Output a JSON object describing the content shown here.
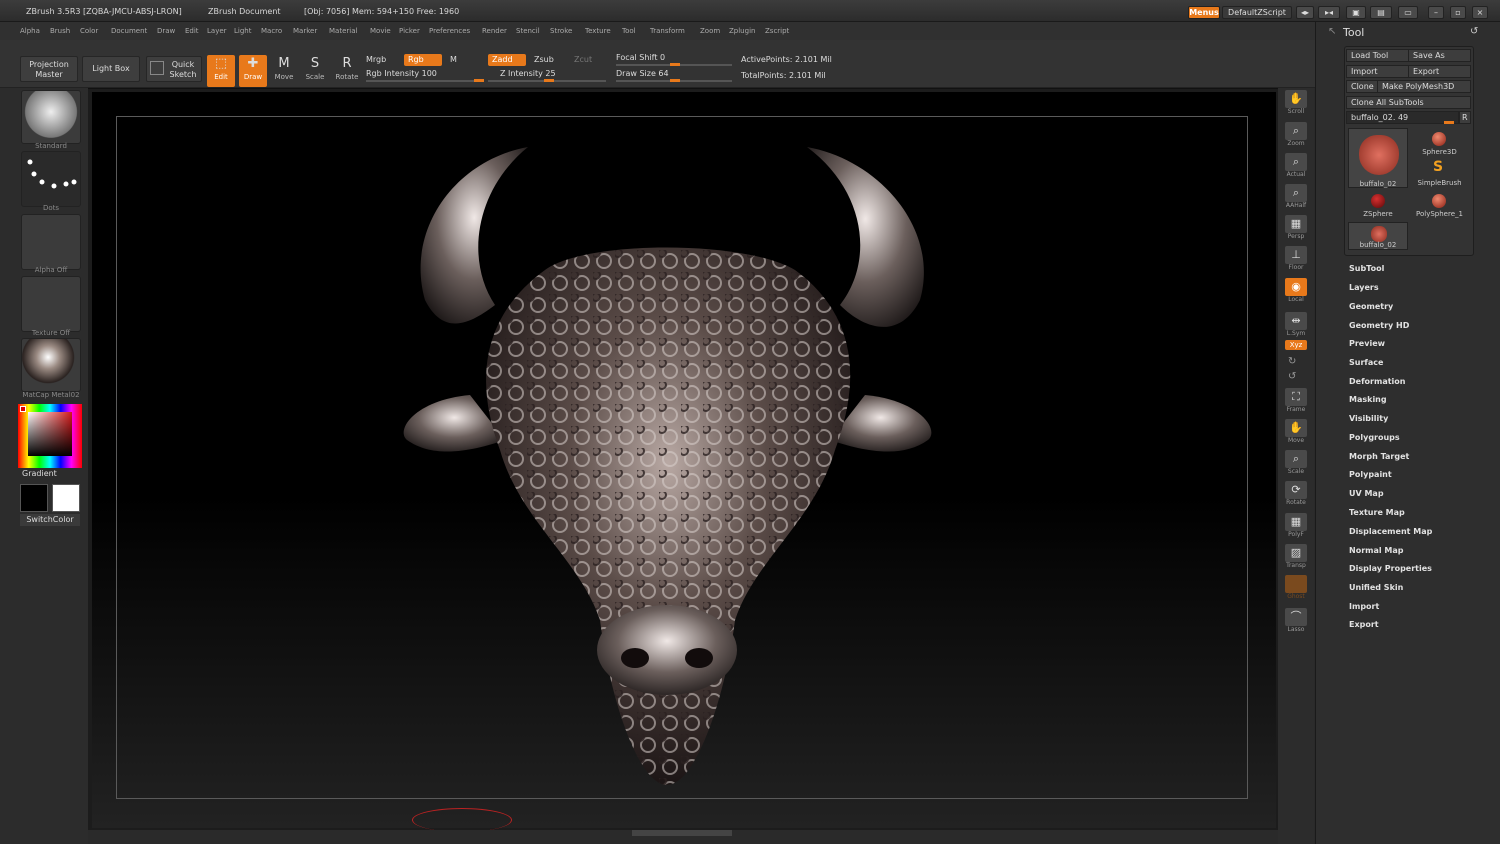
{
  "title_bar": {
    "app": "ZBrush 3.5R3 [ZQBA-JMCU-ABSJ-LRON]",
    "document": "ZBrush Document",
    "stats": "[Obj: 7056] Mem: 594+150 Free: 1960",
    "menus_label": "Menus",
    "script_label": "DefaultZScript"
  },
  "menu_items": [
    "Alpha",
    "Brush",
    "Color",
    "Document",
    "Draw",
    "Edit",
    "Layer",
    "Light",
    "Macro",
    "Marker",
    "Material",
    "Movie",
    "Picker",
    "Preferences",
    "Render",
    "Stencil",
    "Stroke",
    "Texture",
    "Tool",
    "Transform",
    "Zoom",
    "Zplugin",
    "Zscript"
  ],
  "toolbar": {
    "projection_master": "Projection Master",
    "light_box": "Light Box",
    "quick_sketch": "Quick Sketch",
    "edit": "Edit",
    "draw": "Draw",
    "move": "Move",
    "scale": "Scale",
    "rotate": "Rotate",
    "mrgb": "Mrgb",
    "rgb": "Rgb",
    "m": "M",
    "rgb_intensity": "Rgb Intensity 100",
    "zadd": "Zadd",
    "zsub": "Zsub",
    "zcut": "Zcut",
    "z_intensity": "Z Intensity 25",
    "focal_shift": "Focal Shift 0",
    "draw_size": "Draw Size 64",
    "active_points": "ActivePoints: 2.101 Mil",
    "total_points": "TotalPoints: 2.101 Mil"
  },
  "left_shelf": {
    "brush_label": "Standard",
    "stroke_label": "Dots",
    "alpha_label": "Alpha Off",
    "texture_label": "Texture Off",
    "material_label": "MatCap Metal02",
    "gradient_label": "Gradient",
    "switch_label": "SwitchColor"
  },
  "right_shelf": [
    "Scroll",
    "Zoom",
    "Actual",
    "AAHalf",
    "Persp",
    "Floor",
    "Local",
    "L.Sym",
    "Xyz",
    "Frame",
    "Move",
    "Scale",
    "Rotate",
    "PolyF",
    "Transp",
    "Ghost",
    "Lasso"
  ],
  "tool_panel": {
    "title": "Tool",
    "load_tool": "Load Tool",
    "save_as": "Save As",
    "import": "Import",
    "export": "Export",
    "clone": "Clone",
    "make_polymesh": "Make PolyMesh3D",
    "clone_all": "Clone All SubTools",
    "current_tool": "buffalo_02. 49",
    "r_label": "R",
    "tools": [
      "buffalo_02",
      "Sphere3D",
      "SimpleBrush",
      "ZSphere",
      "PolySphere_1",
      "buffalo_02"
    ],
    "sections": [
      "SubTool",
      "Layers",
      "Geometry",
      "Geometry HD",
      "Preview",
      "Surface",
      "Deformation",
      "Masking",
      "Visibility",
      "Polygroups",
      "Morph Target",
      "Polypaint",
      "UV Map",
      "Texture Map",
      "Displacement Map",
      "Normal Map",
      "Display Properties",
      "Unified Skin",
      "Import",
      "Export"
    ]
  }
}
